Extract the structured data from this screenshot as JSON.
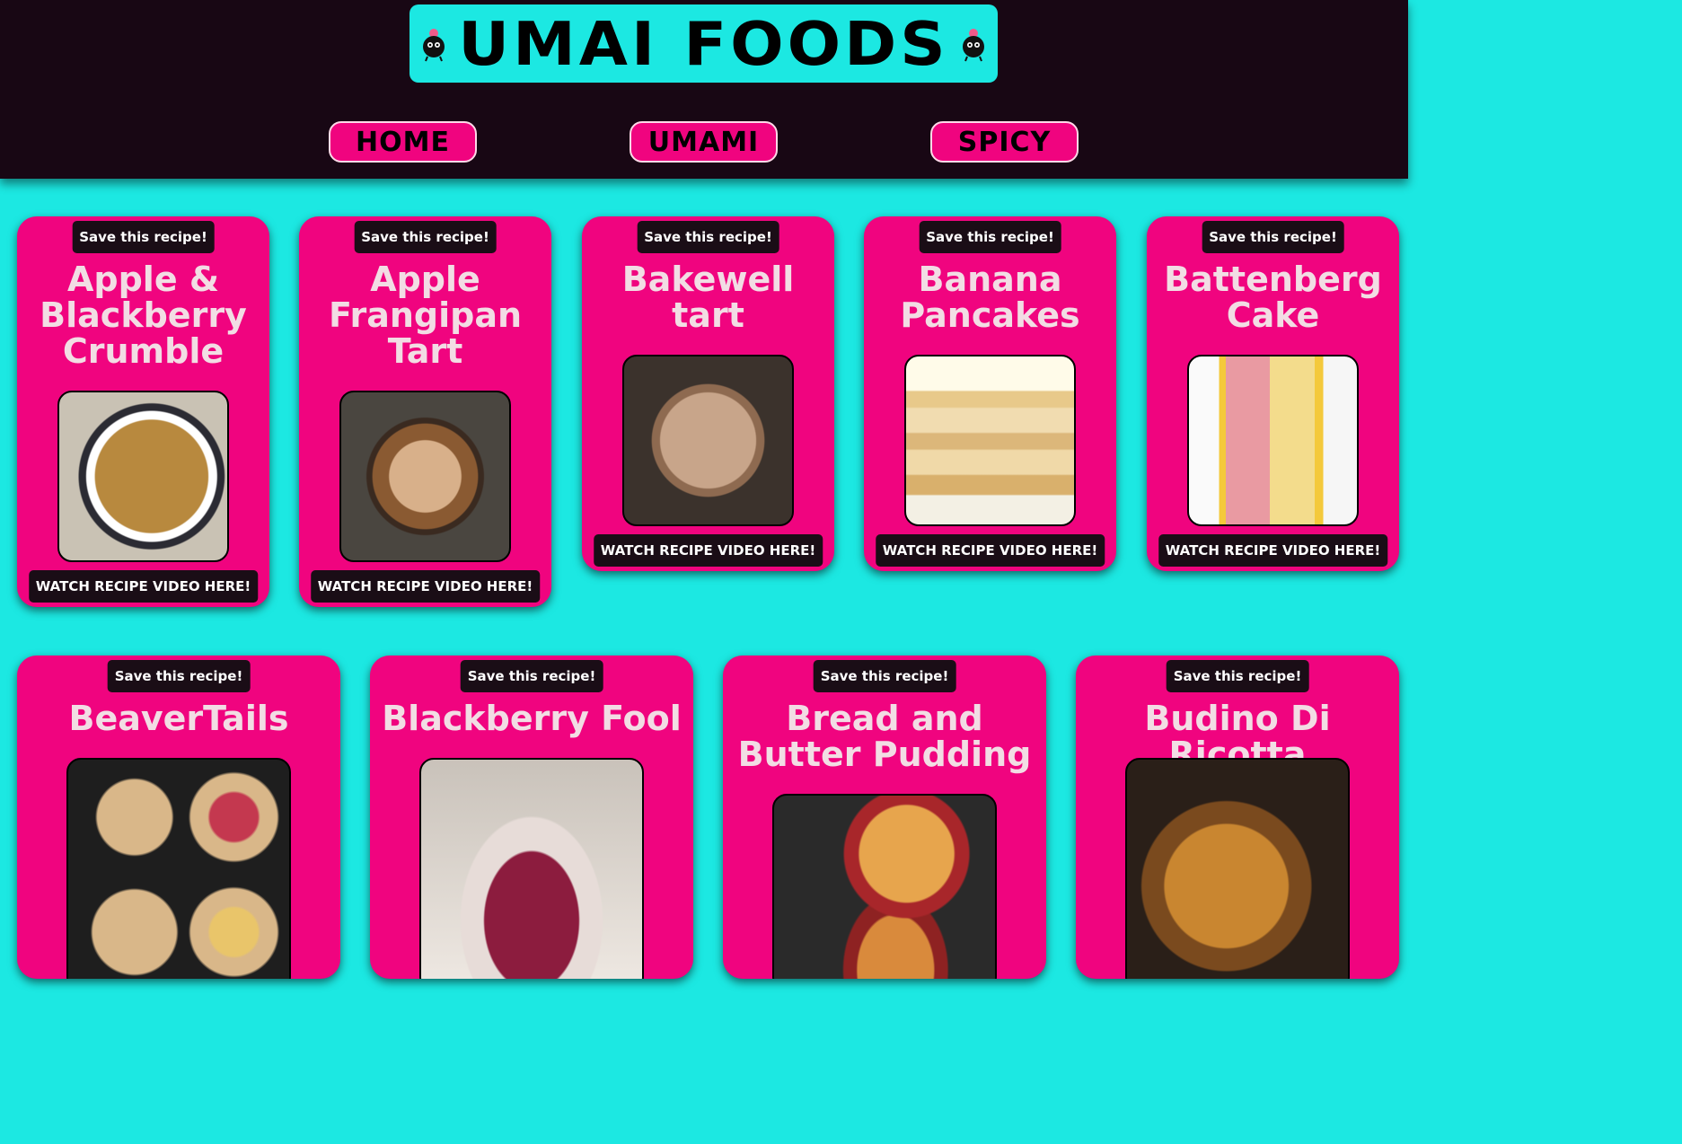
{
  "site": {
    "title": "UMAI FOODS",
    "colors": {
      "header_bg": "#180714",
      "accent": "#1ce8e2",
      "card": "#f0047f",
      "title_text": "#f2dde4"
    }
  },
  "nav": [
    {
      "label": "HOME"
    },
    {
      "label": "UMAMI"
    },
    {
      "label": "SPICY"
    }
  ],
  "cards": [
    {
      "save": "Save this recipe!",
      "title": "Apple & Blackberry Crumble",
      "watch": "WATCH RECIPE VIDEO HERE!"
    },
    {
      "save": "Save this recipe!",
      "title": "Apple Frangipan Tart",
      "watch": "WATCH RECIPE VIDEO HERE!"
    },
    {
      "save": "Save this recipe!",
      "title": "Bakewell tart",
      "watch": "WATCH RECIPE VIDEO HERE!"
    },
    {
      "save": "Save this recipe!",
      "title": "Banana Pancakes",
      "watch": "WATCH RECIPE VIDEO HERE!"
    },
    {
      "save": "Save this recipe!",
      "title": "Battenberg Cake",
      "watch": "WATCH RECIPE VIDEO HERE!"
    },
    {
      "save": "Save this recipe!",
      "title": "BeaverTails"
    },
    {
      "save": "Save this recipe!",
      "title": "Blackberry Fool"
    },
    {
      "save": "Save this recipe!",
      "title": "Bread and Butter Pudding"
    },
    {
      "save": "Save this recipe!",
      "title": "Budino Di Ricotta"
    }
  ]
}
